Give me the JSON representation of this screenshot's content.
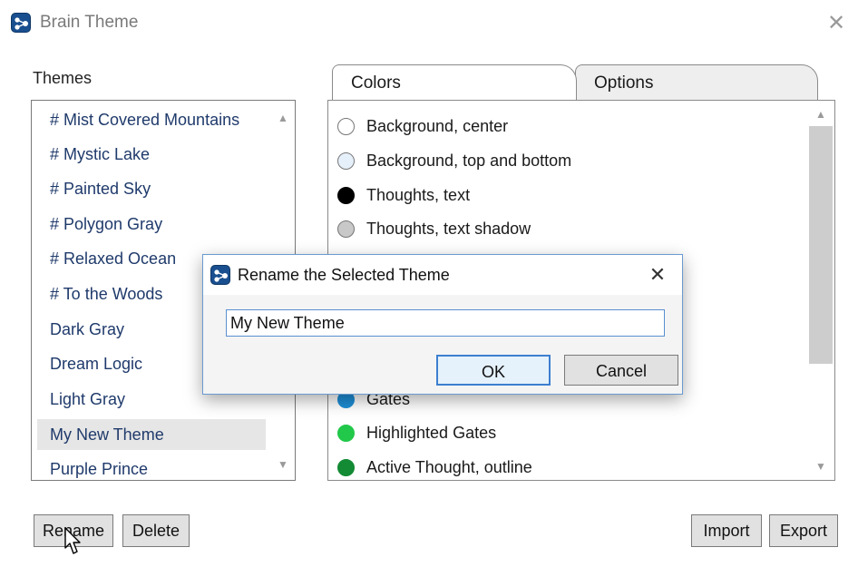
{
  "window": {
    "title": "Brain Theme",
    "close_icon": "✕"
  },
  "themes": {
    "label": "Themes",
    "items": [
      {
        "label": "# Mist Covered Mountains",
        "selected": false
      },
      {
        "label": "# Mystic Lake",
        "selected": false
      },
      {
        "label": "# Painted Sky",
        "selected": false
      },
      {
        "label": "# Polygon Gray",
        "selected": false
      },
      {
        "label": "# Relaxed Ocean",
        "selected": false
      },
      {
        "label": "# To the Woods",
        "selected": false
      },
      {
        "label": "Dark Gray",
        "selected": false
      },
      {
        "label": "Dream Logic",
        "selected": false
      },
      {
        "label": "Light Gray",
        "selected": false
      },
      {
        "label": "My New Theme",
        "selected": true
      },
      {
        "label": "Purple Prince",
        "selected": false
      }
    ]
  },
  "tabs": {
    "colors": "Colors",
    "options": "Options"
  },
  "colors": [
    {
      "label": "Background, center",
      "swatch": "#ffffff"
    },
    {
      "label": "Background, top and bottom",
      "swatch": "#e6f0fa"
    },
    {
      "label": "Thoughts, text",
      "swatch": "#000000"
    },
    {
      "label": "Thoughts, text shadow",
      "swatch": "#c8c8c8"
    },
    {
      "label": "Gates",
      "swatch": "#1e8fd6"
    },
    {
      "label": "Highlighted Gates",
      "swatch": "#22c84a"
    },
    {
      "label": "Active Thought, outline",
      "swatch": "#138a34"
    }
  ],
  "buttons": {
    "rename": "Rename",
    "delete": "Delete",
    "import": "Import",
    "export": "Export"
  },
  "dialog": {
    "title": "Rename the Selected Theme",
    "close_icon": "✕",
    "input_value": "My New Theme",
    "ok": "OK",
    "cancel": "Cancel"
  },
  "colors_accent": {
    "dialog_border": "#6a9ad0",
    "list_text": "#1f3a6b"
  }
}
